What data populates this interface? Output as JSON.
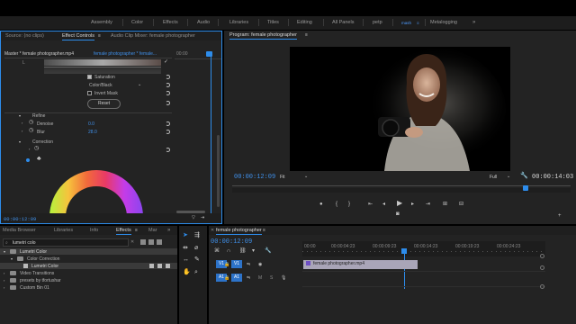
{
  "workspaces": [
    "Assembly",
    "Color",
    "Effects",
    "Audio",
    "Libraries",
    "Titles",
    "Editing",
    "All Panels",
    "petp",
    "mash",
    "Metalogging"
  ],
  "active_workspace_index": 9,
  "source_panel": {
    "tabs": [
      "Source: (no clips)",
      "Effect Controls",
      "Audio Clip Mixer: female photographer"
    ],
    "active_tab_index": 1,
    "master_label": "Master * female photographer.mp4",
    "clip_label": "female photographer * female...",
    "ruler_time": "00:00",
    "row_L": "L",
    "saturation_label": "Saturation",
    "color_black_value": "Color/Black",
    "invert_mask_label": "Invert Mask",
    "reset_button_label": "Reset",
    "refine_label": "Refine",
    "denoise_label": "Denoise",
    "denoise_value": "0.0",
    "blur_label": "Blur",
    "blur_value": "28.0",
    "correction_label": "Correction",
    "timecode": "00:00:12:09"
  },
  "program_monitor": {
    "title": "Program: female photographer",
    "timecode": "00:00:12:09",
    "fit_label": "Fit",
    "quality_label": "Full",
    "duration": "00:00:14:03"
  },
  "effects_panel": {
    "tabs": [
      "Media Browser",
      "Libraries",
      "Info",
      "Effects",
      "Mar"
    ],
    "active_tab_index": 3,
    "search_value": "lumetri colo",
    "items": [
      {
        "label": "Lumetri Color",
        "expanded": true,
        "selected": true
      },
      {
        "label": "Color Correction",
        "expanded": true,
        "selected": false
      },
      {
        "label": "Lumetri Color",
        "expanded": false,
        "selected": true
      },
      {
        "label": "Video Transitions",
        "expanded": false,
        "selected": false
      },
      {
        "label": "presets by tfortushar",
        "expanded": false,
        "selected": false
      },
      {
        "label": "Custom Bin 01",
        "expanded": false,
        "selected": false
      }
    ]
  },
  "timeline": {
    "title": "female photographer",
    "timecode": "00:00:12:09",
    "ruler_labels": [
      "00:00",
      "00:00:04:23",
      "00:00:09:23",
      "00:00:14:23",
      "00:00:19:23",
      "00:00:24:23"
    ],
    "tracks": [
      {
        "target": "V1",
        "source": "V1"
      },
      {
        "target": "A1",
        "source": "A1"
      }
    ],
    "track_letters": {
      "mute": "M",
      "solo": "S"
    },
    "clip_label": "female photographer.mp4"
  },
  "colors": {
    "accent": "#2d8ceb",
    "timecode": "#3f8fe8",
    "clip": "#a9a5b8",
    "panel": "#232323"
  }
}
